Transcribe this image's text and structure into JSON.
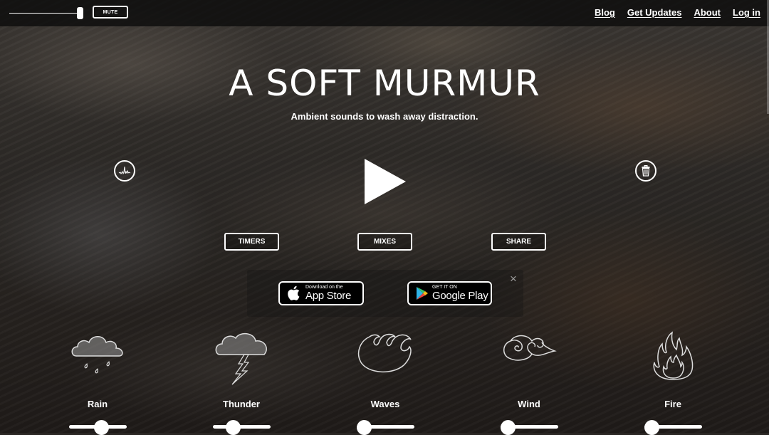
{
  "topbar": {
    "volume": 0.95,
    "mute_label": "MUTE",
    "nav": [
      {
        "label": "Blog"
      },
      {
        "label": "Get Updates"
      },
      {
        "label": "About"
      },
      {
        "label": "Log in"
      }
    ]
  },
  "hero": {
    "title": "A SOFT MURMUR",
    "subtitle": "Ambient sounds to wash away distraction."
  },
  "controls": {
    "left_icon": "waveform-icon",
    "right_icon": "trash-icon",
    "play_icon": "play-icon",
    "buttons": [
      {
        "label": "TIMERS"
      },
      {
        "label": "MIXES"
      },
      {
        "label": "SHARE"
      }
    ]
  },
  "app_banner": {
    "app_store": {
      "small": "Download on the",
      "big": "App Store"
    },
    "google_play": {
      "small": "GET IT ON",
      "big": "Google Play"
    },
    "close_label": "×"
  },
  "sounds": [
    {
      "label": "Rain",
      "icon": "rain-cloud-icon",
      "volume": 0.55
    },
    {
      "label": "Thunder",
      "icon": "thunder-cloud-icon",
      "volume": 0.35
    },
    {
      "label": "Waves",
      "icon": "waves-icon",
      "volume": 0
    },
    {
      "label": "Wind",
      "icon": "wind-icon",
      "volume": 0
    },
    {
      "label": "Fire",
      "icon": "fire-icon",
      "volume": 0
    }
  ],
  "colors": {
    "text": "#ffffff",
    "topbar_bg": "#0c0c0c",
    "badge_bg": "#000000"
  }
}
